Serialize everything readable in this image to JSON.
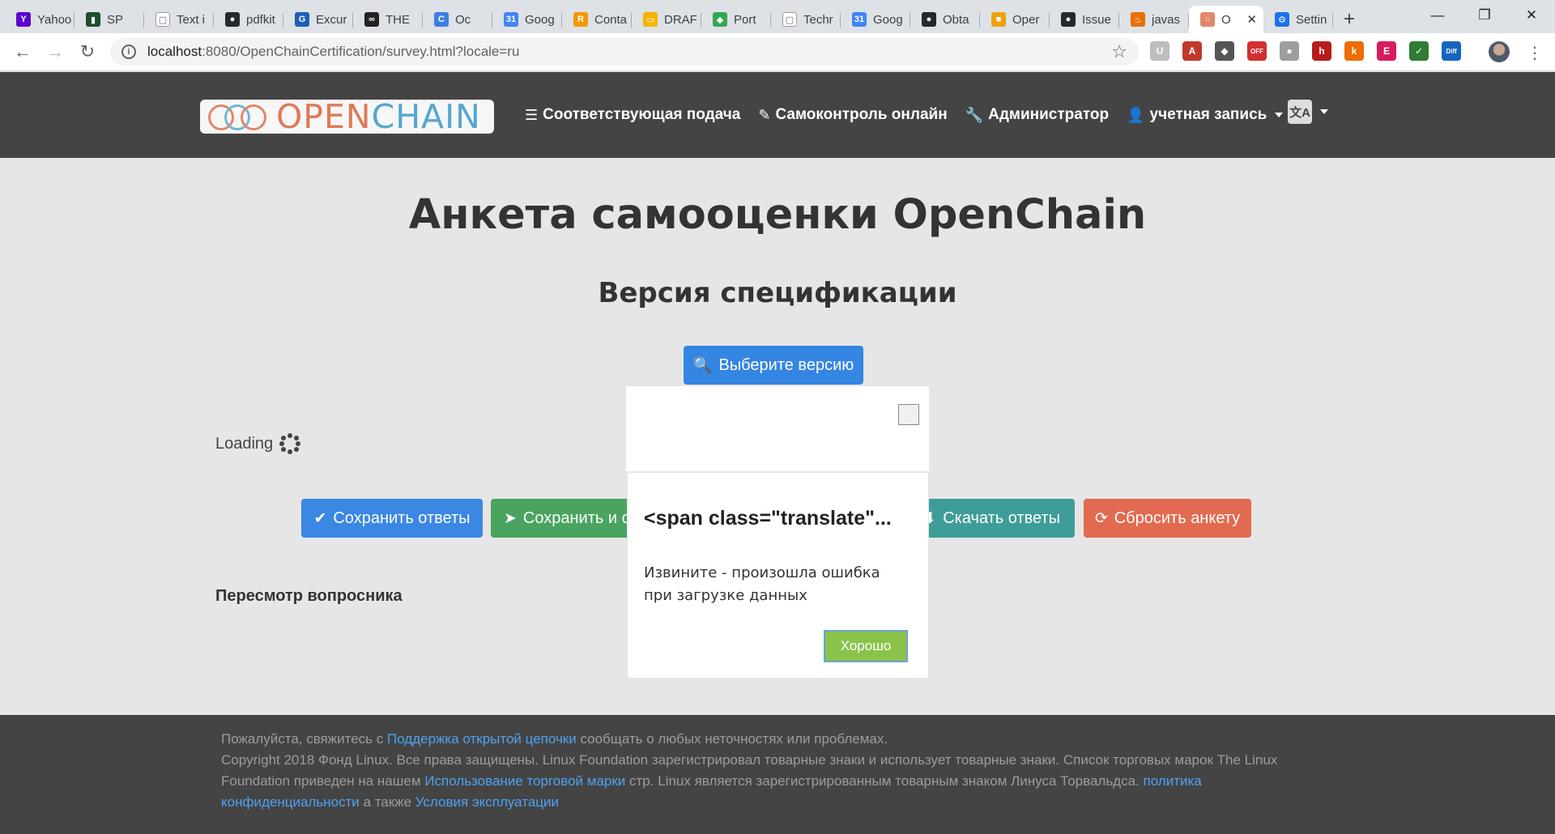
{
  "browser": {
    "tabs": [
      {
        "label": "Yahoo",
        "icon": "yahoo-icon",
        "color": "#5f01d1",
        "glyph": "Y"
      },
      {
        "label": "SP",
        "icon": "chart-favicon-icon",
        "color": "#1e4d2b",
        "glyph": "▮"
      },
      {
        "label": "Text i",
        "icon": "document-icon",
        "color": "#ffffff",
        "glyph": "▢"
      },
      {
        "label": "pdfkit",
        "icon": "github-icon",
        "color": "#24292e",
        "glyph": "●"
      },
      {
        "label": "Excur",
        "icon": "ge-icon",
        "color": "#1f5fb6",
        "glyph": "G"
      },
      {
        "label": "THE",
        "icon": "tripadvisor-icon",
        "color": "#222222",
        "glyph": "∞"
      },
      {
        "label": "Oc",
        "icon": "circle-c-icon",
        "color": "#3d7fe0",
        "glyph": "C"
      },
      {
        "label": "Goog",
        "icon": "calendar-icon",
        "color": "#4285f4",
        "glyph": "31"
      },
      {
        "label": "Conta",
        "icon": "contact-icon",
        "color": "#f29900",
        "glyph": "R"
      },
      {
        "label": "DRAF",
        "icon": "slides-icon",
        "color": "#f4b400",
        "glyph": "▭"
      },
      {
        "label": "Port",
        "icon": "maps-icon",
        "color": "#34a853",
        "glyph": "◆"
      },
      {
        "label": "Techr",
        "icon": "document-icon",
        "color": "#ffffff",
        "glyph": "▢"
      },
      {
        "label": "Goog",
        "icon": "calendar-icon",
        "color": "#4285f4",
        "glyph": "31"
      },
      {
        "label": "Obta",
        "icon": "github-icon",
        "color": "#24292e",
        "glyph": "●"
      },
      {
        "label": "Oper",
        "icon": "box-icon",
        "color": "#f0a20b",
        "glyph": "■"
      },
      {
        "label": "Issue",
        "icon": "github-icon",
        "color": "#24292e",
        "glyph": "●"
      },
      {
        "label": "javas",
        "icon": "java-icon",
        "color": "#e76f00",
        "glyph": "♨"
      },
      {
        "label": "O",
        "icon": "openchain-favicon-icon",
        "color": "#e2876a",
        "glyph": "○",
        "active": true
      },
      {
        "label": "Settin",
        "icon": "gear-icon",
        "color": "#1a73e8",
        "glyph": "⚙"
      }
    ],
    "url_host": "localhost",
    "url_path": ":8080/OpenChainCertification/survey.html?locale=ru",
    "extensions": [
      {
        "name": "ext-grey-icon",
        "color": "#bdbdbd",
        "glyph": "U"
      },
      {
        "name": "ext-pdf-icon",
        "color": "#c0392b",
        "glyph": "A"
      },
      {
        "name": "ext-shield-icon",
        "color": "#555555",
        "glyph": "◆"
      },
      {
        "name": "ext-off-icon",
        "color": "#d32f2f",
        "glyph": "OFF"
      },
      {
        "name": "ext-circle-icon",
        "color": "#9e9e9e",
        "glyph": "●"
      },
      {
        "name": "ext-h-icon",
        "color": "#b71c1c",
        "glyph": "h"
      },
      {
        "name": "ext-k-icon",
        "color": "#ef6c00",
        "glyph": "k"
      },
      {
        "name": "ext-e-icon",
        "color": "#d81b60",
        "glyph": "E"
      },
      {
        "name": "ext-check-icon",
        "color": "#2e7d32",
        "glyph": "✓"
      },
      {
        "name": "ext-diff-icon",
        "color": "#1565c0",
        "glyph": "Diff"
      }
    ]
  },
  "nav": {
    "logo_part1": "OPEN",
    "logo_part2": "CHAIN",
    "links": [
      {
        "icon": "list-icon",
        "glyph": "☰",
        "label": "Соответствующая подача"
      },
      {
        "icon": "pencil-icon",
        "glyph": "✎",
        "label": "Самоконтроль онлайн"
      },
      {
        "icon": "wrench-icon",
        "glyph": "🔧",
        "label": "Администратор"
      },
      {
        "icon": "user-icon",
        "glyph": "👤",
        "label": "учетная запись"
      }
    ],
    "lang_glyph": "文A"
  },
  "main": {
    "title": "Анкета самооценки OpenChain",
    "subtitle": "Версия спецификации",
    "select_version": "Выберите версию",
    "loading": "Loading",
    "save_answers": "Сохранить ответы",
    "submit_answers": "Сохранить и отправить",
    "download_answers": "Скачать ответы",
    "reset_survey": "Сбросить анкету",
    "review_heading": "Пересмотр вопросника"
  },
  "modal": {
    "heading": "<span class=\"translate\"...",
    "message": "Извините - произошла ошибка при загрузке данных",
    "ok": "Хорошо"
  },
  "footer": {
    "line1_pre": "Пожалуйста, свяжитесь с ",
    "support_link": "Поддержка открытой цепочки",
    "line1_post": " сообщать о любых неточностях или проблемах.",
    "copyright": "Copyright 2018 Фонд Linux. Все права защищены. Linux Foundation зарегистрировал товарные знаки и использует товарные знаки. Список торговых марок The Linux Foundation приведен на нашем ",
    "trademark_link": "Использование торговой марки",
    "copyright_post": " стр. Linux является зарегистрированным товарным знаком Линуса Торвальдса. ",
    "privacy_link": "политика конфиденциальности",
    "and": " а также ",
    "terms_link": "Условия эксплуатации"
  }
}
